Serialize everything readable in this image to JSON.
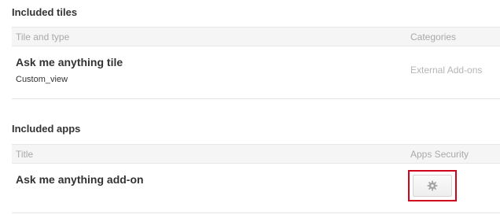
{
  "tiles_section": {
    "heading": "Included tiles",
    "columns": {
      "tile_and_type": "Tile and type",
      "categories": "Categories"
    },
    "rows": [
      {
        "title": "Ask me anything tile",
        "type": "Custom_view",
        "category": "External Add-ons"
      }
    ]
  },
  "apps_section": {
    "heading": "Included apps",
    "columns": {
      "title": "Title",
      "apps_security": "Apps Security"
    },
    "rows": [
      {
        "title": "Ask me anything add-on",
        "security_icon": "gear-icon"
      }
    ]
  },
  "colors": {
    "highlight_border": "#d0021b",
    "header_background": "#f5f5f5",
    "muted_text": "#a9a9a9"
  }
}
